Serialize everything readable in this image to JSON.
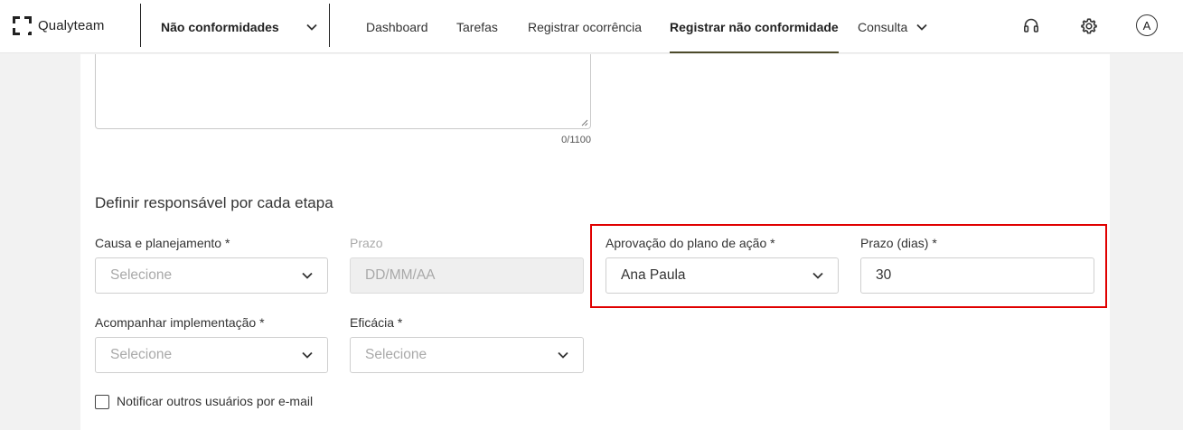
{
  "brand": {
    "name": "Qualyteam"
  },
  "module": {
    "label": "Não conformidades"
  },
  "nav": {
    "items": [
      {
        "label": "Dashboard"
      },
      {
        "label": "Tarefas"
      },
      {
        "label": "Registrar ocorrência"
      },
      {
        "label": "Registrar não conformidade",
        "active": true
      },
      {
        "label": "Consulta"
      }
    ]
  },
  "header_icons": [
    "headset-icon",
    "gear-icon"
  ],
  "avatar": {
    "initial": "A"
  },
  "description": {
    "counter": "0/1100"
  },
  "responsibles": {
    "title": "Definir responsável por cada etapa",
    "causa": {
      "label": "Causa e planejamento *",
      "placeholder": "Selecione"
    },
    "prazo_causa": {
      "label": "Prazo",
      "placeholder": "DD/MM/AA"
    },
    "aprovacao": {
      "label": "Aprovação do plano de ação *",
      "value": "Ana Paula"
    },
    "prazo_dias": {
      "label": "Prazo (dias) *",
      "value": "30"
    },
    "acompanhar": {
      "label": "Acompanhar implementação *",
      "placeholder": "Selecione"
    },
    "eficacia": {
      "label": "Eficácia *",
      "placeholder": "Selecione"
    },
    "notify": {
      "label": "Notificar outros usuários por e-mail",
      "checked": false
    }
  },
  "colors": {
    "highlight": "#e00000",
    "active_underline": "#4d4a2a"
  }
}
